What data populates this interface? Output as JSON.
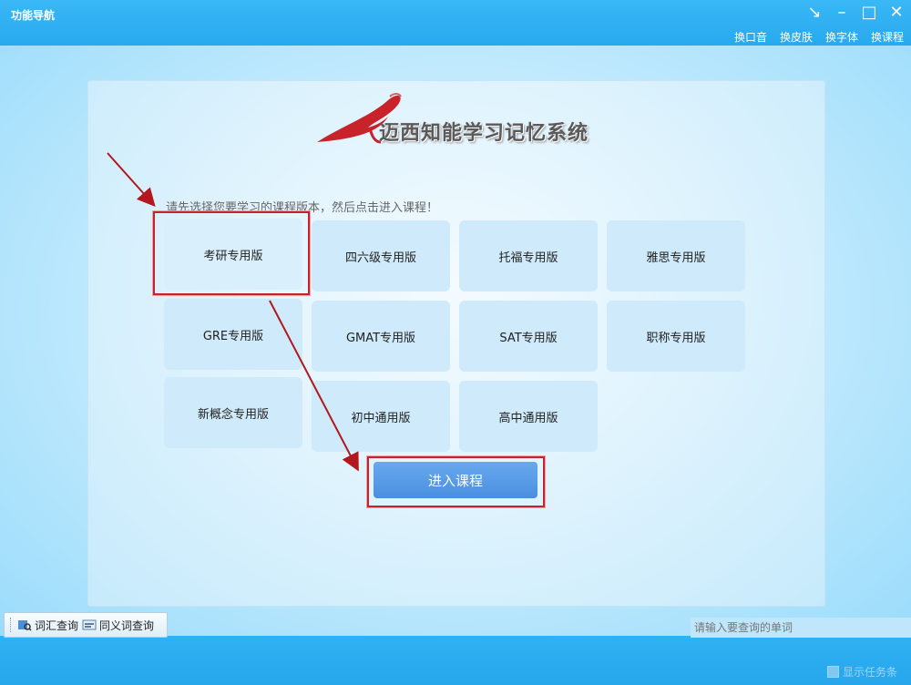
{
  "window": {
    "title": "功能导航"
  },
  "top_menu": [
    "换口音",
    "换皮肤",
    "换字体",
    "换课程"
  ],
  "logo": {
    "text": "迈西知能学习记忆系统"
  },
  "hint": "请先选择您要学习的课程版本，然后点击进入课程！",
  "courses": [
    "考研专用版",
    "四六级专用版",
    "托福专用版",
    "雅思专用版",
    "GRE专用版",
    "GMAT专用版",
    "SAT专用版",
    "职称专用版",
    "新概念专用版",
    "初中通用版",
    "高中通用版"
  ],
  "selected_course": "考研专用版",
  "enter_button": "进入课程",
  "toolbar": {
    "vocab_lookup": "词汇查询",
    "synonym_lookup": "同义词查询"
  },
  "search": {
    "placeholder": "请输入要查询的单词"
  },
  "taskbar_toggle": "显示任务条",
  "colors": {
    "accent_blue": "#2aaaf0",
    "highlight_red": "#c8232a",
    "button_blue": "#5599e6"
  }
}
